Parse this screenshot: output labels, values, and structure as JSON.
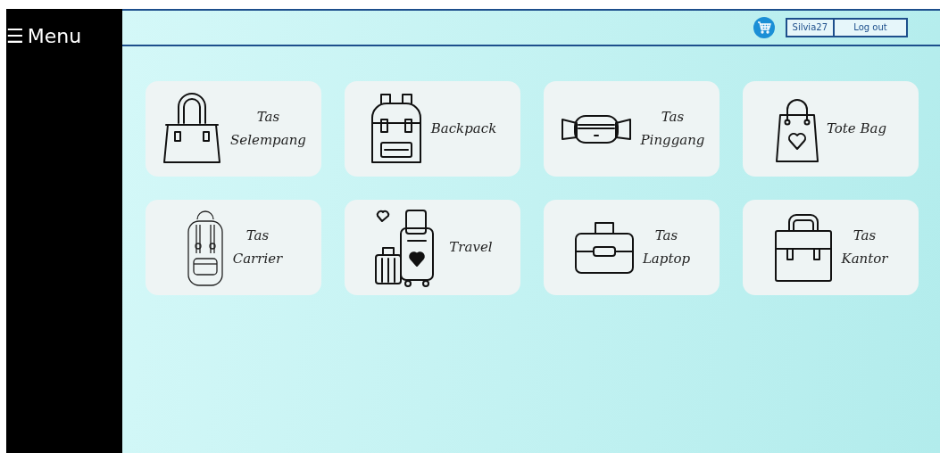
{
  "sidebar": {
    "menu_icon": "☰",
    "title": "Menu"
  },
  "header": {
    "user": "Silvia27",
    "logout": "Log out"
  },
  "categories": [
    {
      "kind": "handbag",
      "lines": [
        "Tas",
        "Selempang"
      ]
    },
    {
      "kind": "backpack",
      "lines": [
        "Backpack"
      ]
    },
    {
      "kind": "waistbag",
      "lines": [
        "Tas",
        "Pinggang"
      ]
    },
    {
      "kind": "tote",
      "lines": [
        "Tote Bag"
      ]
    },
    {
      "kind": "carrier",
      "lines": [
        "Tas",
        "Carrier"
      ]
    },
    {
      "kind": "luggage",
      "lines": [
        "Travel"
      ]
    },
    {
      "kind": "laptop",
      "lines": [
        "Tas",
        "Laptop"
      ]
    },
    {
      "kind": "briefcase",
      "lines": [
        "Tas",
        "Kantor"
      ]
    }
  ]
}
